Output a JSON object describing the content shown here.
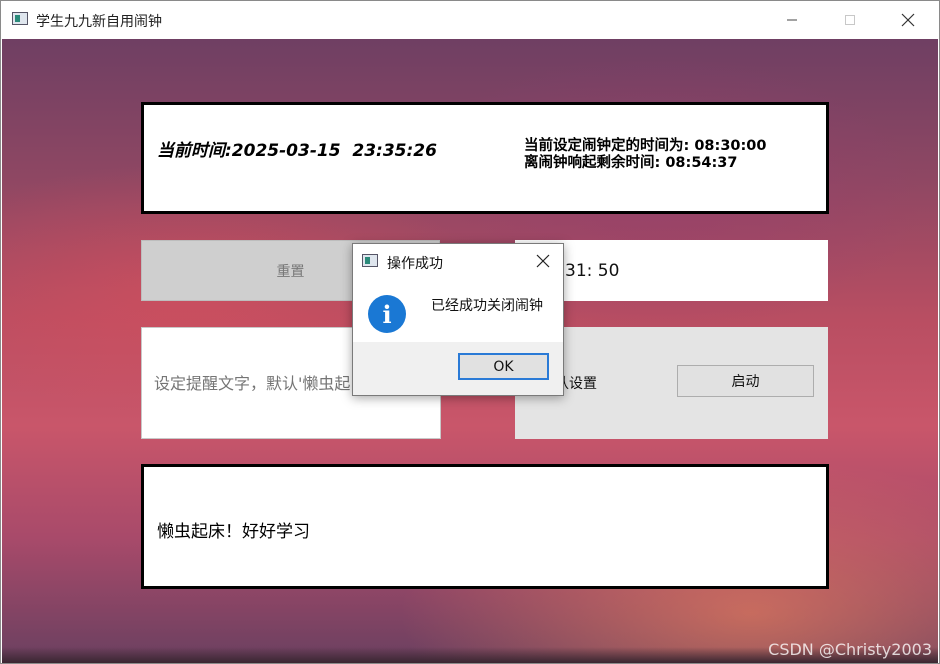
{
  "window": {
    "title": "学生九九新自用闹钟",
    "icons": {
      "app": "app-window-icon",
      "minimize": "minimize-icon",
      "maximize": "maximize-icon",
      "close": "close-icon"
    }
  },
  "time_panel": {
    "current_time": "当前时间:2025-03-15  23:35:26",
    "alarm_set_time": "当前设定闹钟定的时间为: 08:30:00",
    "remaining_time": "离闹钟响起剩余时间: 08:54:37"
  },
  "controls": {
    "reset_label": "重置",
    "alarm_time_display": "31:  50",
    "remind_placeholder": "设定提醒文字，默认'懒虫起",
    "default_setting_label": "认设置",
    "start_label": "启动"
  },
  "message_panel": {
    "text": "懒虫起床！好好学习"
  },
  "dialog": {
    "title": "操作成功",
    "message": "已经成功关闭闹钟",
    "ok_label": "OK",
    "icon": "info-icon"
  },
  "watermark": "CSDN @Christy2003",
  "colors": {
    "dialog_accent": "#2a7ad6",
    "info_icon": "#1a78d4"
  }
}
